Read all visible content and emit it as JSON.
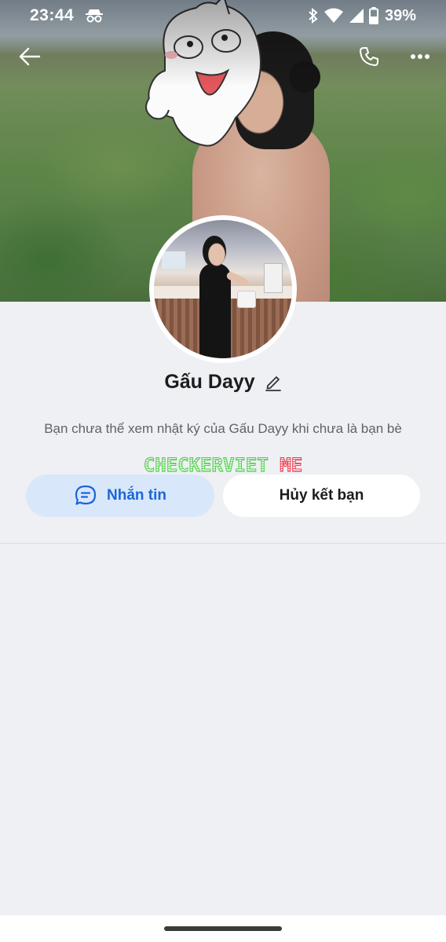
{
  "status_bar": {
    "time": "23:44",
    "battery_percent": "39%",
    "icons": [
      "incognito-icon",
      "bluetooth-icon",
      "wifi-icon",
      "signal-icon",
      "battery-icon"
    ]
  },
  "header": {
    "icons": [
      "back-arrow-icon",
      "phone-icon",
      "more-dots-icon"
    ]
  },
  "profile": {
    "name": "Gấu Dayy",
    "privacy_note": "Bạn chưa thể xem nhật ký của Gấu Dayy khi chưa là bạn bè"
  },
  "watermark": {
    "part1": "CHECKERVIET",
    "part2": "ME"
  },
  "actions": {
    "message_label": "Nhắn tin",
    "unfriend_label": "Hủy kết bạn"
  },
  "colors": {
    "accent": "#1a66d9",
    "message_bg": "#d9e7fb",
    "page_bg": "#eef0f3"
  }
}
